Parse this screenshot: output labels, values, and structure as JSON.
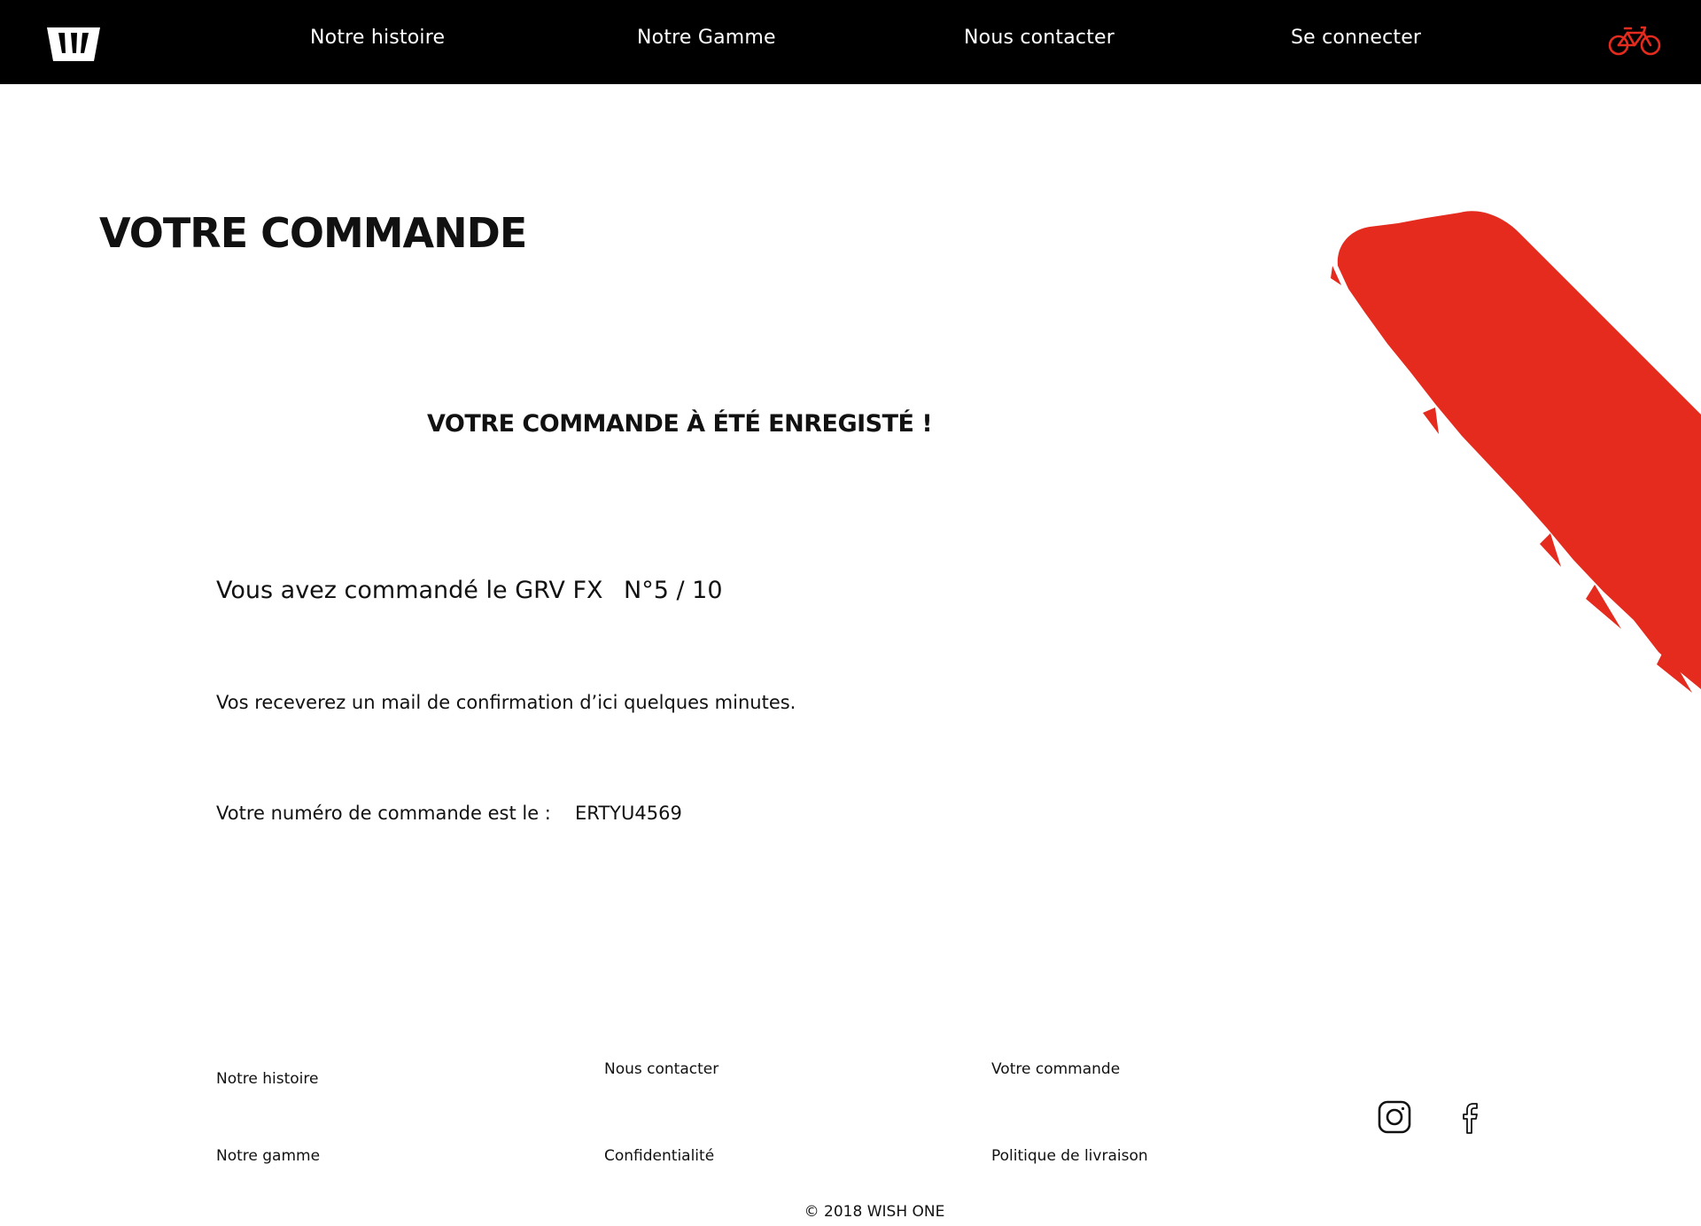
{
  "header": {
    "nav": [
      {
        "label": "Notre histoire"
      },
      {
        "label": "Notre Gamme"
      },
      {
        "label": "Nous contacter"
      },
      {
        "label": "Se connecter"
      }
    ],
    "cart_icon": "bicycle-icon",
    "logo_icon": "wish-one-logo"
  },
  "main": {
    "title": "VOTRE COMMANDE",
    "success_message": "VOTRE COMMANDE À ÉTÉ ENREGISTÉ !",
    "ordered_text": "Vous avez commandé le GRV FX",
    "serial_text": "N°5 / 10",
    "confirmation_text": "Vos receverez un mail de confirmation d’ici quelques minutes.",
    "order_number_label": "Votre numéro de commande est le :",
    "order_number_value": "ERTYU4569"
  },
  "footer": {
    "links": [
      {
        "label": "Notre histoire"
      },
      {
        "label": "Notre gamme"
      },
      {
        "label": "Nous contacter"
      },
      {
        "label": "Confidentialité"
      },
      {
        "label": "Votre commande"
      },
      {
        "label": "Politique de livraison"
      }
    ],
    "social": [
      "instagram-icon",
      "facebook-icon"
    ],
    "copyright": "© 2018 WISH ONE"
  },
  "colors": {
    "header_bg": "#000000",
    "accent": "#e52b1e",
    "text": "#111111"
  }
}
